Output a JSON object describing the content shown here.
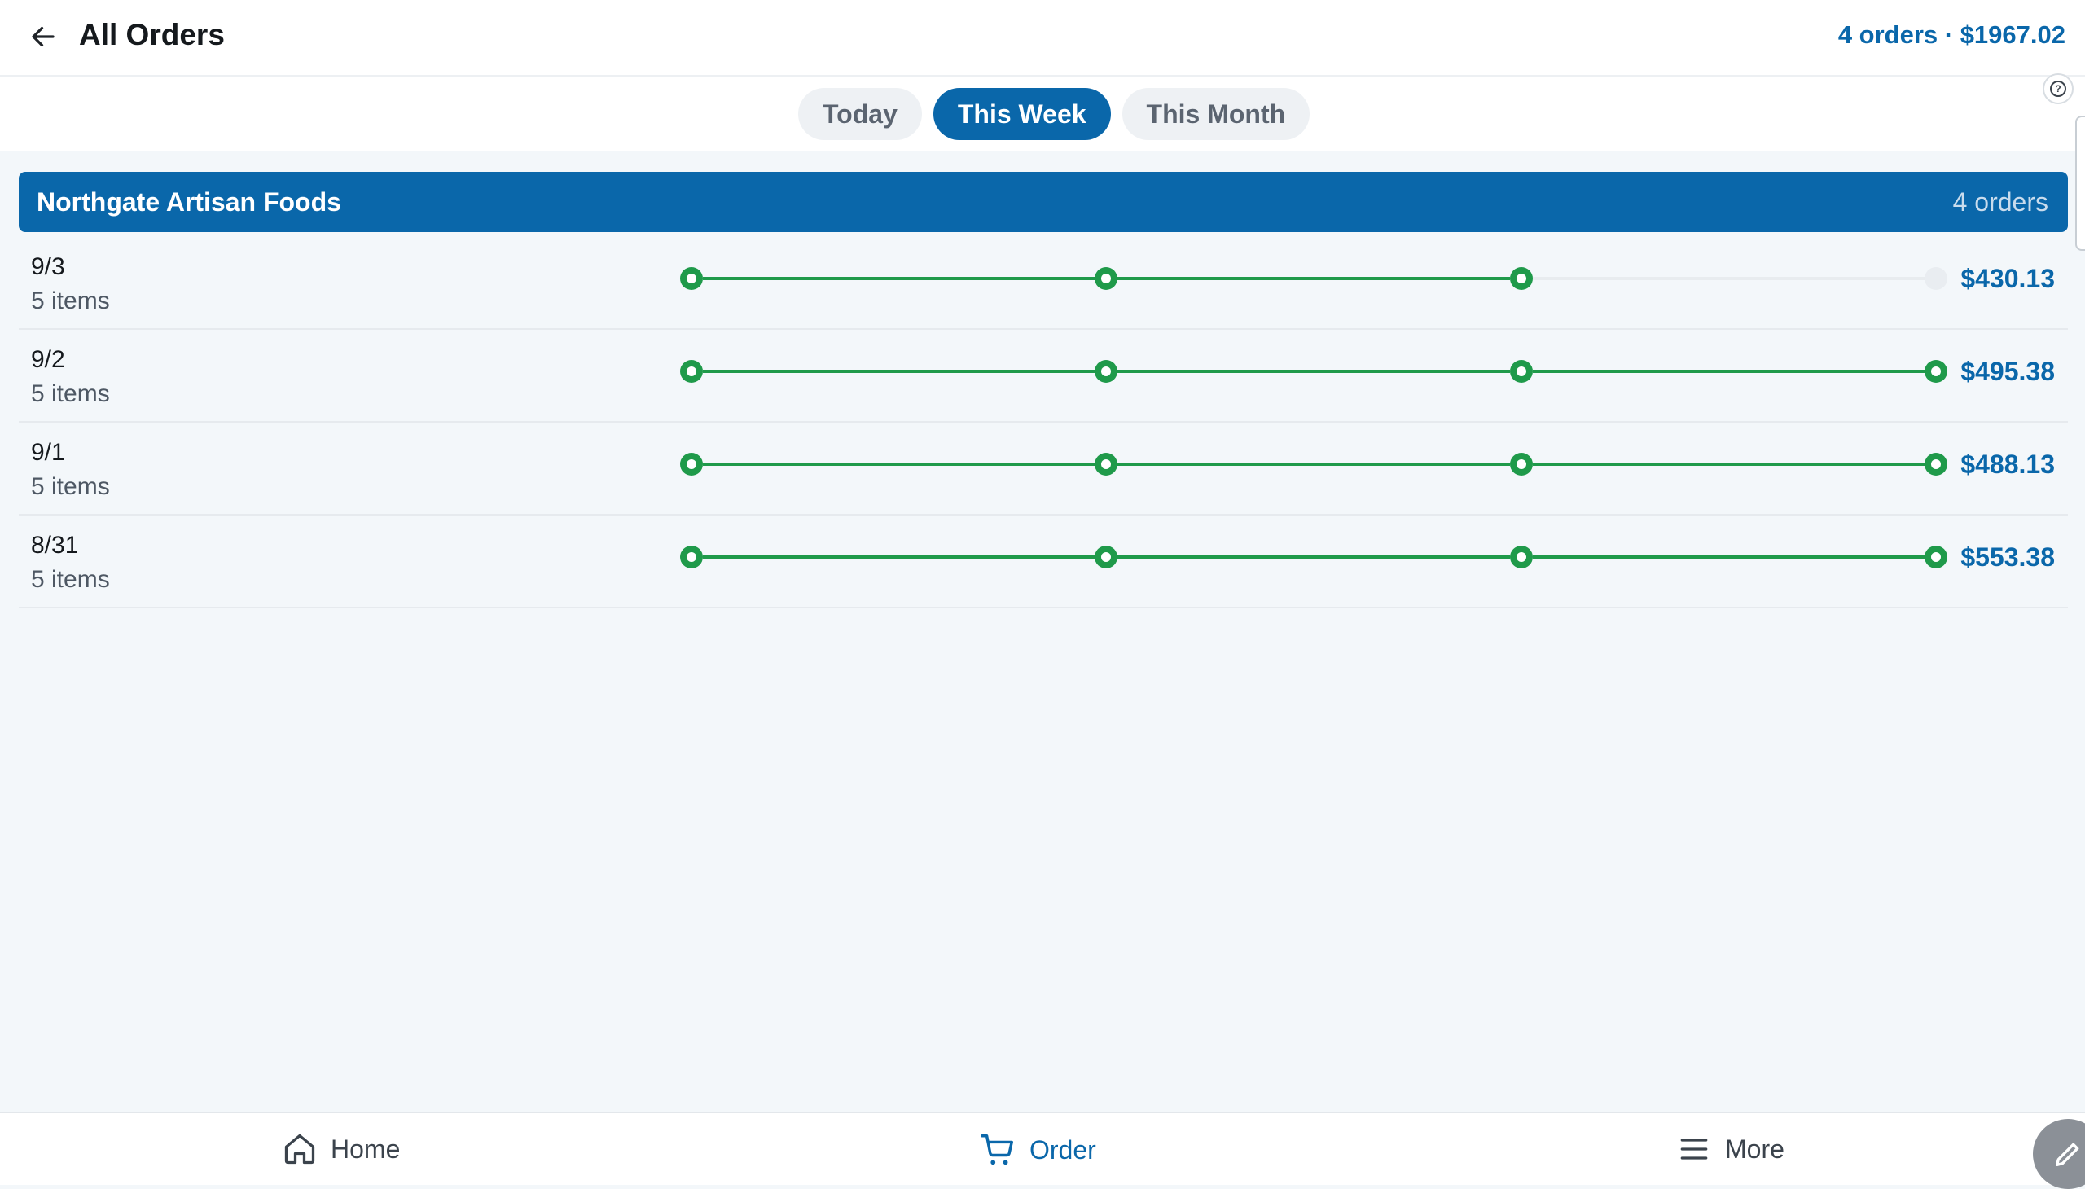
{
  "header": {
    "title": "All Orders",
    "summary": "4 orders · $1967.02"
  },
  "filters": {
    "tabs": [
      {
        "label": "Today",
        "active": false
      },
      {
        "label": "This Week",
        "active": true
      },
      {
        "label": "This Month",
        "active": false
      }
    ]
  },
  "group": {
    "name": "Northgate Artisan Foods",
    "count_label": "4 orders"
  },
  "orders": [
    {
      "date": "9/3",
      "items": "5 items",
      "amount": "$430.13",
      "steps_completed": 3,
      "steps_total": 4
    },
    {
      "date": "9/2",
      "items": "5 items",
      "amount": "$495.38",
      "steps_completed": 4,
      "steps_total": 4
    },
    {
      "date": "9/1",
      "items": "5 items",
      "amount": "$488.13",
      "steps_completed": 4,
      "steps_total": 4
    },
    {
      "date": "8/31",
      "items": "5 items",
      "amount": "$553.38",
      "steps_completed": 4,
      "steps_total": 4
    }
  ],
  "nav": {
    "items": [
      {
        "label": "Home",
        "icon": "home-icon",
        "active": false
      },
      {
        "label": "Order",
        "icon": "cart-icon",
        "active": true
      },
      {
        "label": "More",
        "icon": "menu-icon",
        "active": false
      }
    ]
  },
  "colors": {
    "primary": "#0a67aa",
    "progress_done": "#1f9a4a",
    "progress_todo": "#e8ecef"
  }
}
